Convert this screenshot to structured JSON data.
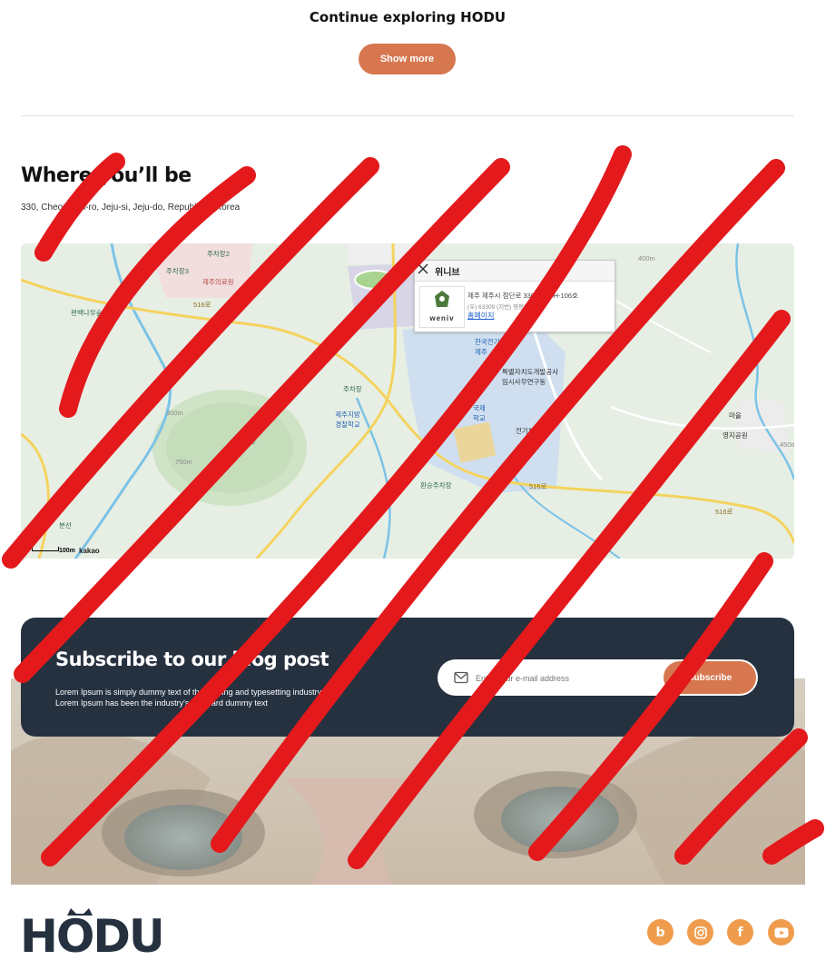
{
  "explore": {
    "title": "Continue exploring HODU",
    "show_more_label": "Show more"
  },
  "location": {
    "title": "Where you’ll be",
    "address": "330, Cheomdan-ro, Jeju-si, Jeju-do, Republic of Korea"
  },
  "map": {
    "popup": {
      "title": "위니브",
      "address": "제주 제주시 첨단로 330 1층 CH-106호",
      "address_sub": "(우) 63309 (지번) 영평동 2181",
      "logo_text": "weniv",
      "homepage_link": "홈페이지"
    },
    "labels": {
      "parking2": "주차장2",
      "parking3": "주차장3",
      "jeju_clinic": "제주의료원",
      "pine_forest": "편백나무숲",
      "road_516a": "516로",
      "road_516b": "516로",
      "road_516c": "516로",
      "parking_a": "주차장",
      "police_school": "제주지방\n경찰학교",
      "samuibong": "삼의봉",
      "bunseon": "분선",
      "parking_b": "환승주차장",
      "kepco": "한국전기\n제주",
      "institute": "특별자치도개발공사\n임시사무연구동",
      "intl_school": "국제\n학교",
      "ev": "전기차충",
      "park": "영지공원",
      "town": "마을",
      "elev_400": "400m",
      "elev_450": "450m",
      "elev_300": "300m",
      "elev_750": "750m"
    },
    "scale_label": "100m",
    "provider": "kakao"
  },
  "subscribe": {
    "title": "Subscribe to our blog post",
    "description": "Lorem Ipsum is simply dummy text of the printing and typesetting industry. Lorem Ipsum has been the industry's standard dummy text",
    "email_placeholder": "Enter your e-mail address",
    "button_label": "Subscribe"
  },
  "footer": {
    "logo_text": "HODU",
    "socials": [
      {
        "name": "blog",
        "glyph": "b"
      },
      {
        "name": "instagram",
        "glyph": ""
      },
      {
        "name": "facebook",
        "glyph": "f"
      },
      {
        "name": "youtube",
        "glyph": ""
      }
    ]
  },
  "colors": {
    "accent": "#d6774f",
    "dark": "#263140",
    "social": "#ef9d4d",
    "scribble": "#e3191c"
  }
}
